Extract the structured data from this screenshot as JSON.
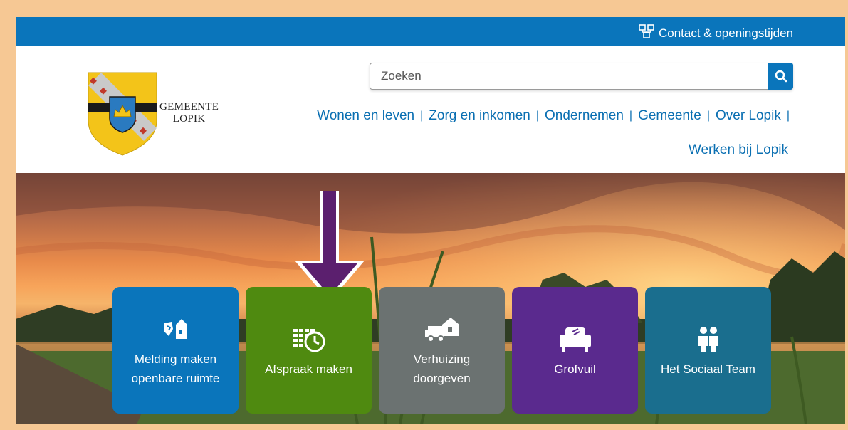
{
  "topbar": {
    "contact_label": "Contact & openingstijden",
    "color": "#0a75bb"
  },
  "logo": {
    "line1": "GEMEENTE",
    "line2": "LOPIK"
  },
  "search": {
    "placeholder": "Zoeken",
    "value": ""
  },
  "nav": {
    "items": [
      "Wonen en leven",
      "Zorg en inkomen",
      "Ondernemen",
      "Gemeente",
      "Over Lopik"
    ],
    "second_row": "Werken bij Lopik"
  },
  "tiles": [
    {
      "label": "Melding maken openbare ruimte",
      "icon": "report-icon",
      "color": "#0a75bb"
    },
    {
      "label": "Afspraak maken",
      "icon": "calendar-clock-icon",
      "color": "#4f8a10"
    },
    {
      "label": "Verhuizing doorgeven",
      "icon": "moving-truck-icon",
      "color": "#6b7271"
    },
    {
      "label": "Grofvuil",
      "icon": "armchair-icon",
      "color": "#5a2a8e"
    },
    {
      "label": "Het Sociaal Team",
      "icon": "team-icon",
      "color": "#1a6e8e"
    }
  ],
  "annotation": {
    "arrow_color": "#5b1f6e"
  }
}
